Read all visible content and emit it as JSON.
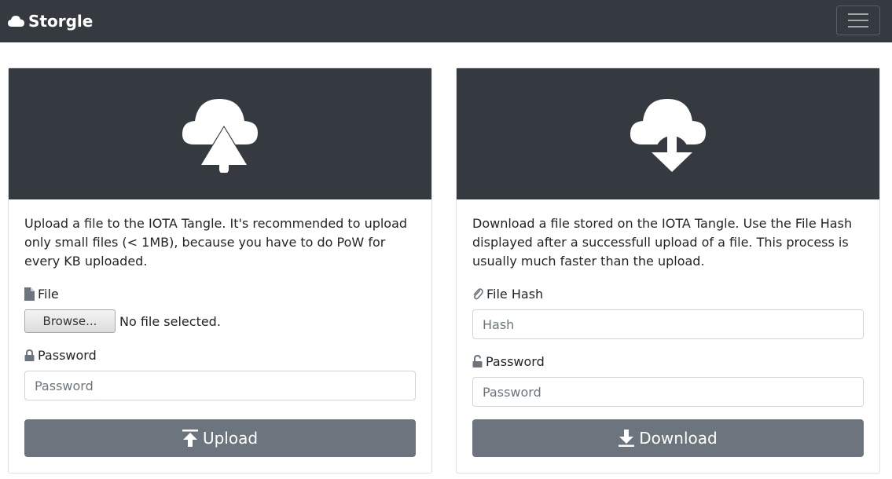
{
  "navbar": {
    "brand": "Storgle",
    "icons": {
      "brand": "cloud-icon",
      "toggler": "hamburger-menu-icon"
    }
  },
  "upload_card": {
    "header_icon": "cloud-upload-icon",
    "description": "Upload a file to the IOTA Tangle. It's recommended to upload only small files (< 1MB), because you have to do PoW for every KB uploaded.",
    "file_label": "File",
    "file_icon": "file-icon",
    "browse_label": "Browse...",
    "file_status": "No file selected.",
    "password_label": "Password",
    "password_icon": "lock-icon",
    "password_placeholder": "Password",
    "button_label": "Upload",
    "button_icon": "upload-arrow-icon"
  },
  "download_card": {
    "header_icon": "cloud-download-icon",
    "description": "Download a file stored on the IOTA Tangle. Use the File Hash displayed after a successfull upload of a file. This process is usually much faster than the upload.",
    "hash_label": "File Hash",
    "hash_icon": "paperclip-icon",
    "hash_placeholder": "Hash",
    "password_label": "Password",
    "password_icon": "unlock-icon",
    "password_placeholder": "Password",
    "button_label": "Download",
    "button_icon": "download-arrow-icon"
  },
  "colors": {
    "navbar_bg": "#343a40",
    "card_header_bg": "#343a40",
    "button_bg": "#6c757d"
  }
}
